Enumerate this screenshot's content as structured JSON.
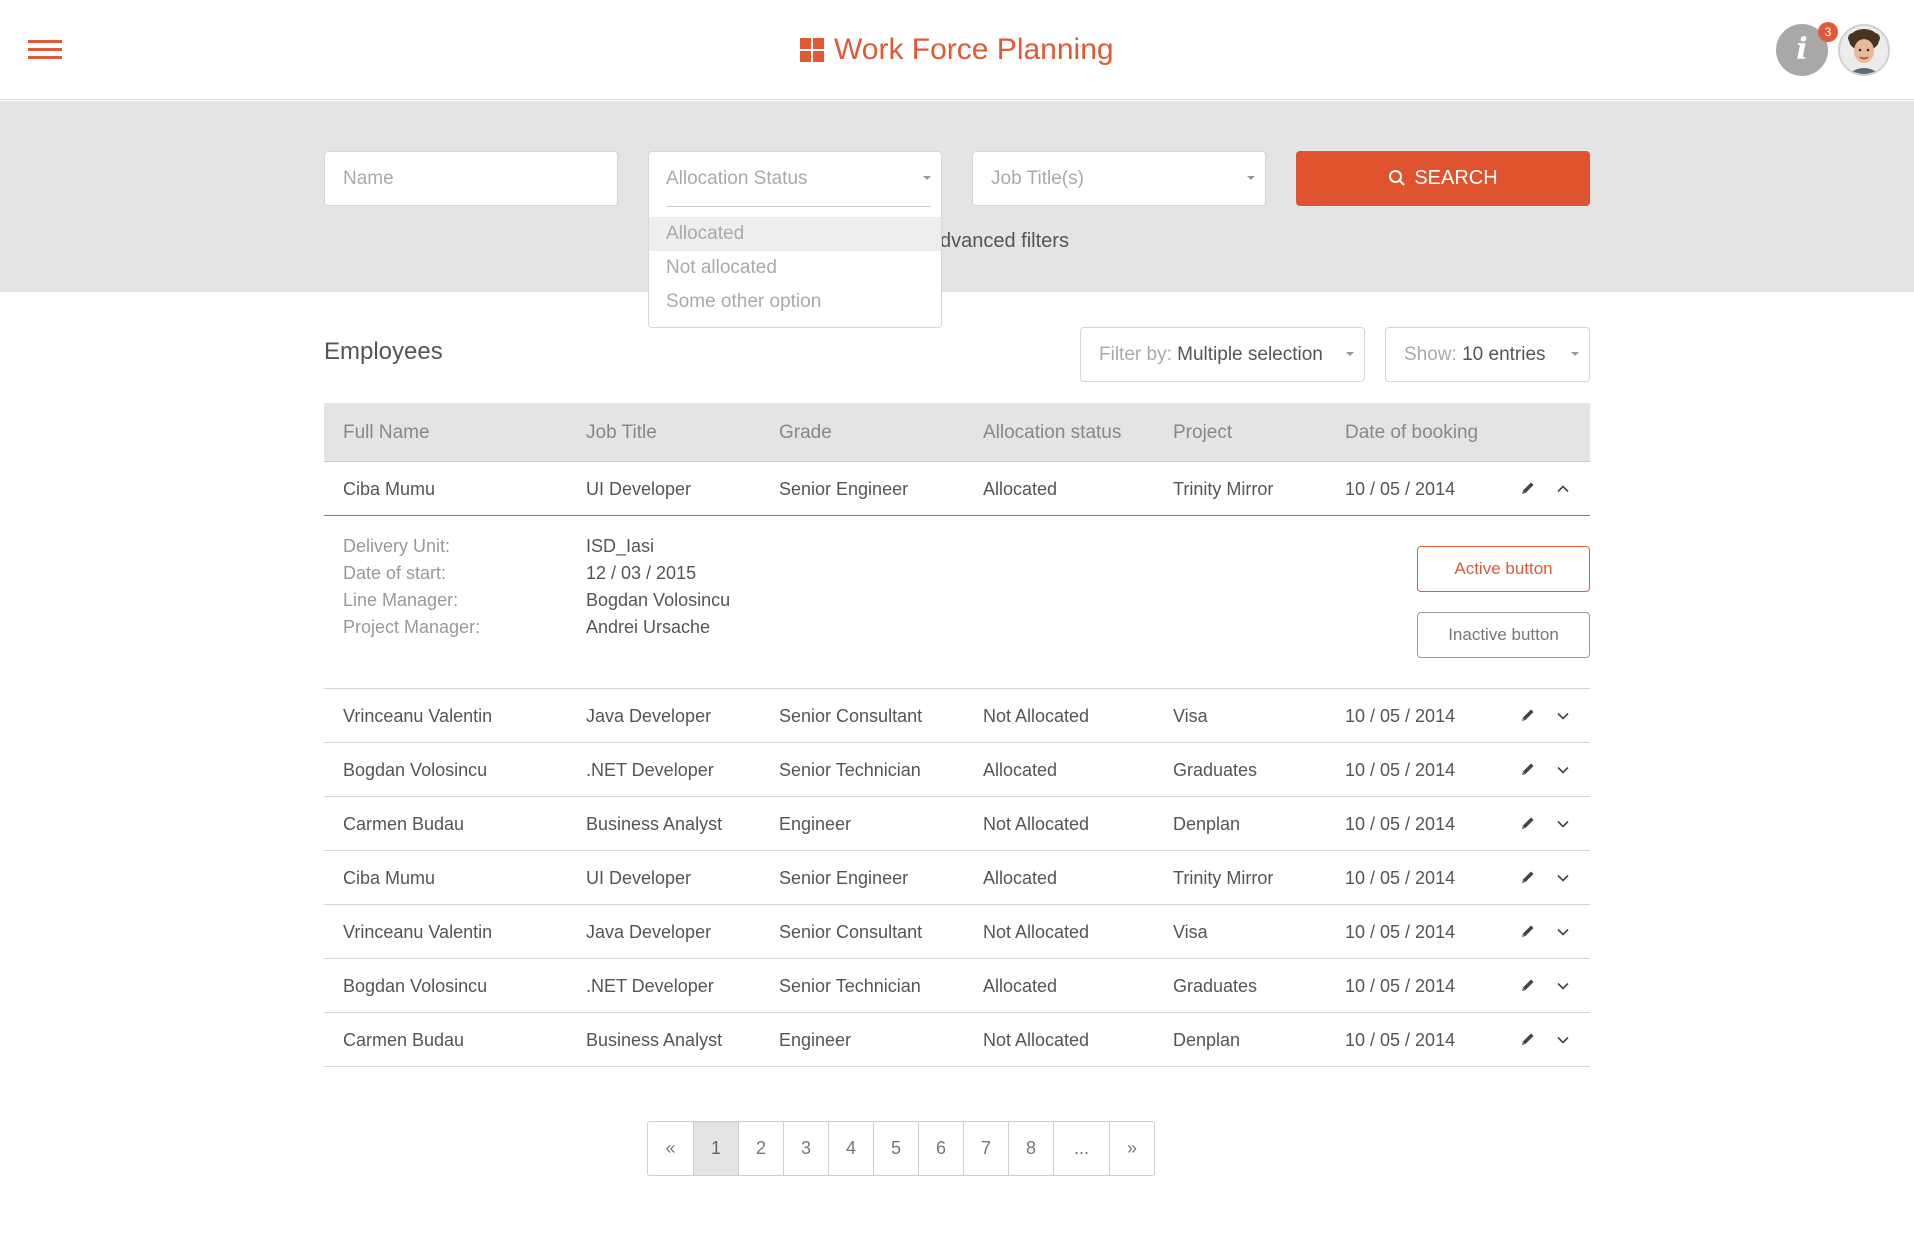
{
  "header": {
    "title": "Work Force Planning",
    "notification_count": "3",
    "info_glyph": "i"
  },
  "filters": {
    "name_placeholder": "Name",
    "allocation_status_placeholder": "Allocation Status",
    "allocation_status_options": [
      "Allocated",
      "Not allocated",
      "Some other option"
    ],
    "job_title_placeholder": "Job Title(s)",
    "search_label": "SEARCH",
    "advanced_filters_partial": "dvanced filters"
  },
  "employees": {
    "title": "Employees",
    "filter_by": {
      "label": "Filter by:",
      "value": "Multiple selection"
    },
    "show": {
      "label": "Show:",
      "value": "10 entries"
    }
  },
  "table": {
    "columns": [
      "Full Name",
      "Job Title",
      "Grade",
      "Allocation status",
      "Project",
      "Date of booking"
    ],
    "rows": [
      [
        "Ciba Mumu",
        "UI Developer",
        "Senior Engineer",
        "Allocated",
        "Trinity Mirror",
        "10 / 05 / 2014"
      ],
      [
        "Vrinceanu Valentin",
        "Java Developer",
        "Senior Consultant",
        "Not Allocated",
        "Visa",
        "10 / 05 / 2014"
      ],
      [
        "Bogdan Volosincu",
        ".NET Developer",
        "Senior Technician",
        "Allocated",
        "Graduates",
        "10 / 05 / 2014"
      ],
      [
        "Carmen Budau",
        "Business Analyst",
        "Engineer",
        "Not Allocated",
        "Denplan",
        "10 / 05 / 2014"
      ],
      [
        "Ciba Mumu",
        "UI Developer",
        "Senior Engineer",
        "Allocated",
        "Trinity Mirror",
        "10 / 05 / 2014"
      ],
      [
        "Vrinceanu Valentin",
        "Java Developer",
        "Senior Consultant",
        "Not Allocated",
        "Visa",
        "10 / 05 / 2014"
      ],
      [
        "Bogdan Volosincu",
        ".NET Developer",
        "Senior Technician",
        "Allocated",
        "Graduates",
        "10 / 05 / 2014"
      ],
      [
        "Carmen Budau",
        "Business Analyst",
        "Engineer",
        "Not Allocated",
        "Denplan",
        "10 / 05 / 2014"
      ]
    ],
    "details": {
      "labels": [
        "Delivery Unit:",
        "Date of start:",
        "Line Manager:",
        "Project Manager:"
      ],
      "values": [
        "ISD_Iasi",
        "12 / 03 / 2015",
        "Bogdan Volosincu",
        "Andrei Ursache"
      ],
      "active_button": "Active button",
      "inactive_button": "Inactive button"
    }
  },
  "pagination": {
    "first": "«",
    "pages": [
      "1",
      "2",
      "3",
      "4",
      "5",
      "6",
      "7",
      "8",
      "..."
    ],
    "last": "»",
    "current": "1"
  },
  "colors": {
    "accent": "#e05a37",
    "search_button": "#df532e",
    "band": "#e4e4e4",
    "info_circle": "#a8a8a8"
  },
  "icons": [
    "hamburger-menu-icon",
    "grid-logo-icon",
    "info-icon",
    "search-icon",
    "pencil-icon",
    "chevron-up-icon",
    "chevron-down-icon"
  ]
}
